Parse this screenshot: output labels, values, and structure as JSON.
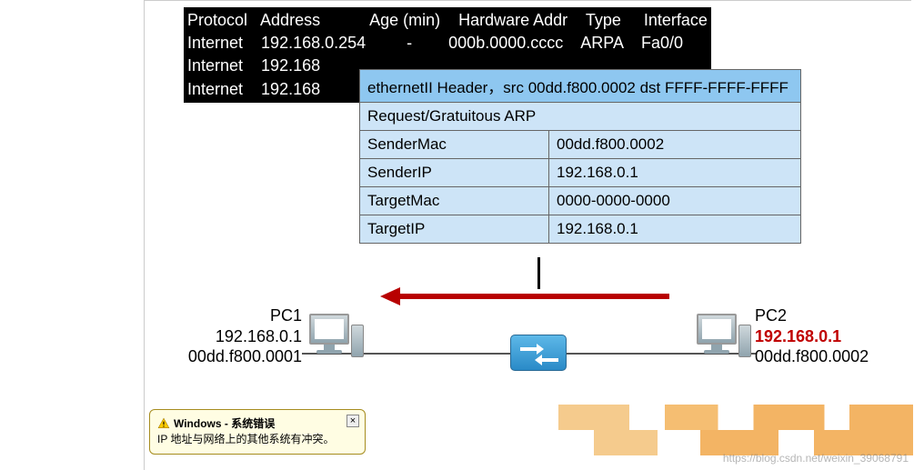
{
  "arp_table": {
    "header_line": "Protocol   Address           Age (min)    Hardware Addr    Type     Interface",
    "rows": [
      "Internet    192.168.0.254         -        000b.0000.cccc    ARPA    Fa0/0",
      "Internet    192.168",
      "Internet    192.168"
    ]
  },
  "packet": {
    "eth_header": "ethernetII Header，src 00dd.f800.0002 dst FFFF-FFFF-FFFF",
    "arp_type": "Request/Gratuitous ARP",
    "fields": [
      {
        "k": "SenderMac",
        "v": "00dd.f800.0002"
      },
      {
        "k": "SenderIP",
        "v": "192.168.0.1"
      },
      {
        "k": "TargetMac",
        "v": "0000-0000-0000"
      },
      {
        "k": "TargetIP",
        "v": "192.168.0.1"
      }
    ]
  },
  "pc1": {
    "name": "PC1",
    "ip": "192.168.0.1",
    "mac": "00dd.f800.0001"
  },
  "pc2": {
    "name": "PC2",
    "ip": "192.168.0.1",
    "mac": "00dd.f800.0002"
  },
  "dialog": {
    "title": "Windows - 系统错误",
    "body": "IP 地址与网络上的其他系统有冲突。"
  },
  "watermark": "https://blog.csdn.net/weixin_39068791"
}
